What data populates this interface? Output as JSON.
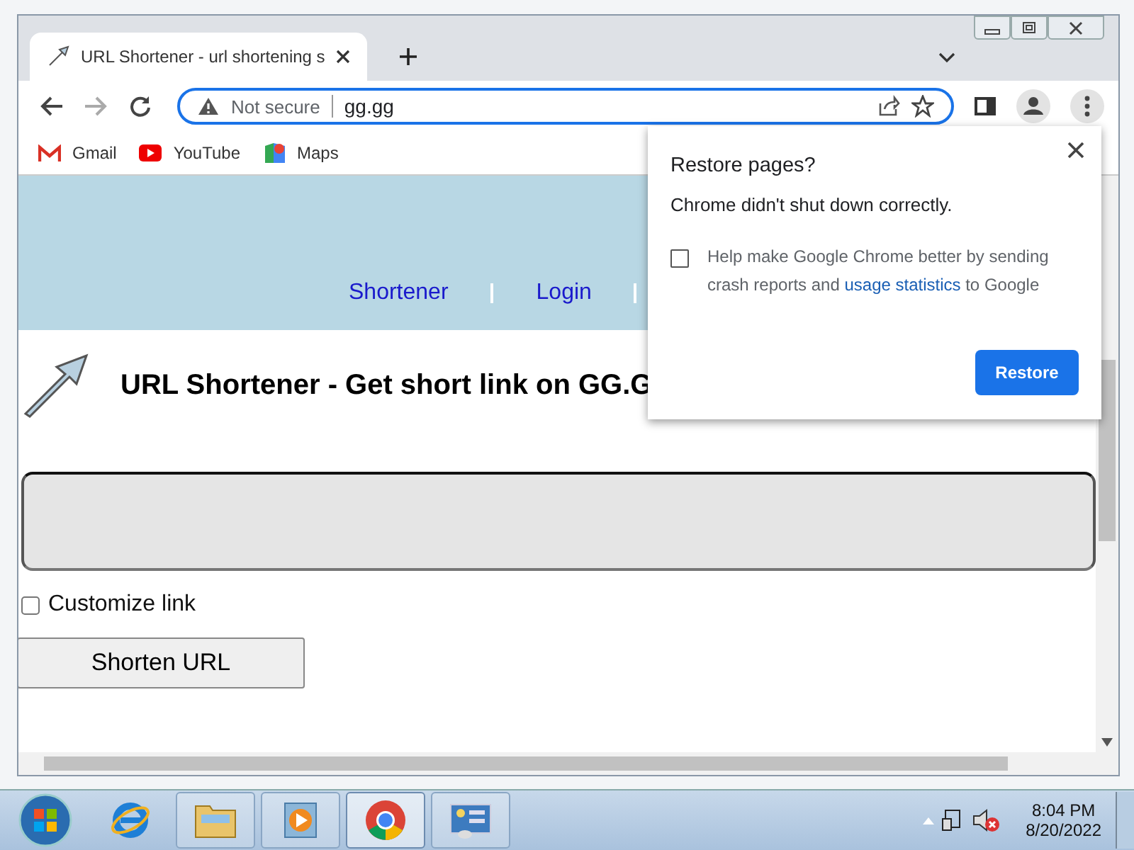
{
  "tabs": [
    {
      "title": "URL Shortener - url shortening s",
      "selected": true
    }
  ],
  "address_bar": {
    "security": "Not secure",
    "url": "gg.gg"
  },
  "bookmarks": [
    {
      "kind": "gmail",
      "label": "Gmail"
    },
    {
      "kind": "youtube",
      "label": "YouTube"
    },
    {
      "kind": "maps",
      "label": "Maps"
    }
  ],
  "page": {
    "nav": [
      "Shortener",
      "Login"
    ],
    "heading": "URL Shortener - Get short link on GG.G",
    "customize": {
      "label": "Customize link",
      "checked": false
    },
    "button": "Shorten URL"
  },
  "dialog": {
    "title": "Restore pages?",
    "message": "Chrome didn't shut down correctly.",
    "consent": {
      "checked": false,
      "text_before": "Help make Google Chrome better by sending crash reports and",
      "link": "usage statistics",
      "text_after": "to Google"
    },
    "button": "Restore"
  },
  "taskbar": {
    "apps": [
      {
        "kind": "ie",
        "selected": false
      },
      {
        "kind": "explorer",
        "selected": false
      },
      {
        "kind": "media",
        "selected": false
      },
      {
        "kind": "chrome",
        "selected": true
      },
      {
        "kind": "panel",
        "selected": false
      }
    ],
    "time": "8:04 PM",
    "date": "8/20/2022"
  }
}
